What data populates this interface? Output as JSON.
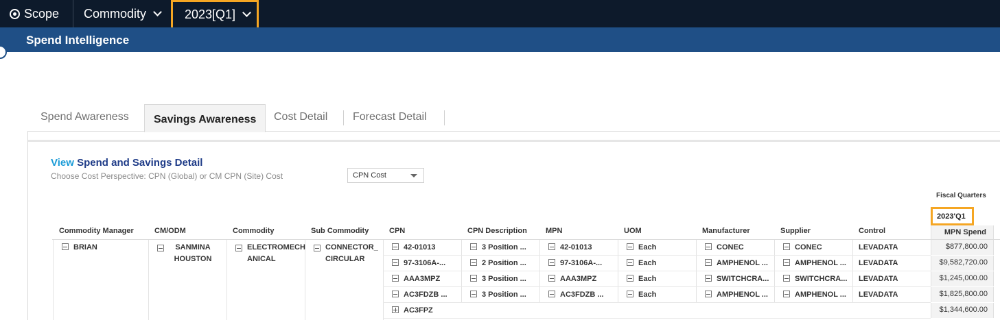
{
  "topbar": {
    "scope_label": "Scope",
    "commodity_label": "Commodity",
    "year_label": "2023[Q1]"
  },
  "subbar": {
    "title": "Spend Intelligence"
  },
  "tabs": [
    {
      "label": "Spend Awareness"
    },
    {
      "label": "Savings Awareness",
      "active": true
    },
    {
      "label": "Cost Detail"
    },
    {
      "label": "Forecast Detail"
    }
  ],
  "view": {
    "title_prefix": "View",
    "title_rest": "Spend and Savings Detail",
    "hint": "Choose Cost Perspective:  CPN (Global) or CM CPN (Site) Cost",
    "cost_select": "CPN Cost"
  },
  "fiscal": {
    "label": "Fiscal Quarters",
    "quarter": "2023'Q1",
    "spend_header": "MPN Spend"
  },
  "table": {
    "headers": [
      "Commodity Manager",
      "CM/ODM",
      "Commodity",
      "Sub Commodity",
      "CPN",
      "CPN Description",
      "MPN",
      "UOM",
      "Manufacturer",
      "Supplier",
      "Control"
    ],
    "group": {
      "manager": "BRIAN",
      "cm_odm": "SANMINA HOUSTON",
      "commodity": "ELECTROMECH ANICAL",
      "sub_commodity": "CONNECTOR_ CIRCULAR"
    },
    "rows": [
      {
        "cpn": "42-01013",
        "desc": "3 Position ...",
        "mpn": "42-01013",
        "uom": "Each",
        "manufacturer": "CONEC",
        "supplier": "CONEC",
        "control": "LEVADATA",
        "spend": "$877,800.00"
      },
      {
        "cpn": "97-3106A-...",
        "desc": "2 Position ...",
        "mpn": "97-3106A-...",
        "uom": "Each",
        "manufacturer": "AMPHENOL ...",
        "supplier": "AMPHENOL ...",
        "control": "LEVADATA",
        "spend": "$9,582,720.00"
      },
      {
        "cpn": "AAA3MPZ",
        "desc": "3 Position ...",
        "mpn": "AAA3MPZ",
        "uom": "Each",
        "manufacturer": "SWITCHCRA...",
        "supplier": "SWITCHCRA...",
        "control": "LEVADATA",
        "spend": "$1,245,000.00"
      },
      {
        "cpn": "AC3FDZB ...",
        "desc": "3 Position ...",
        "mpn": "AC3FDZB ...",
        "uom": "Each",
        "manufacturer": "AMPHENOL ...",
        "supplier": "AMPHENOL ...",
        "control": "LEVADATA",
        "spend": "$1,825,800.00"
      },
      {
        "cpn": "AC3FPZ",
        "spend": "$1,344,600.00"
      }
    ]
  },
  "colors": {
    "topbar": "#0d1a2b",
    "subbar": "#1f4f86",
    "highlight": "#f5a623",
    "link": "#1a9bd7"
  }
}
